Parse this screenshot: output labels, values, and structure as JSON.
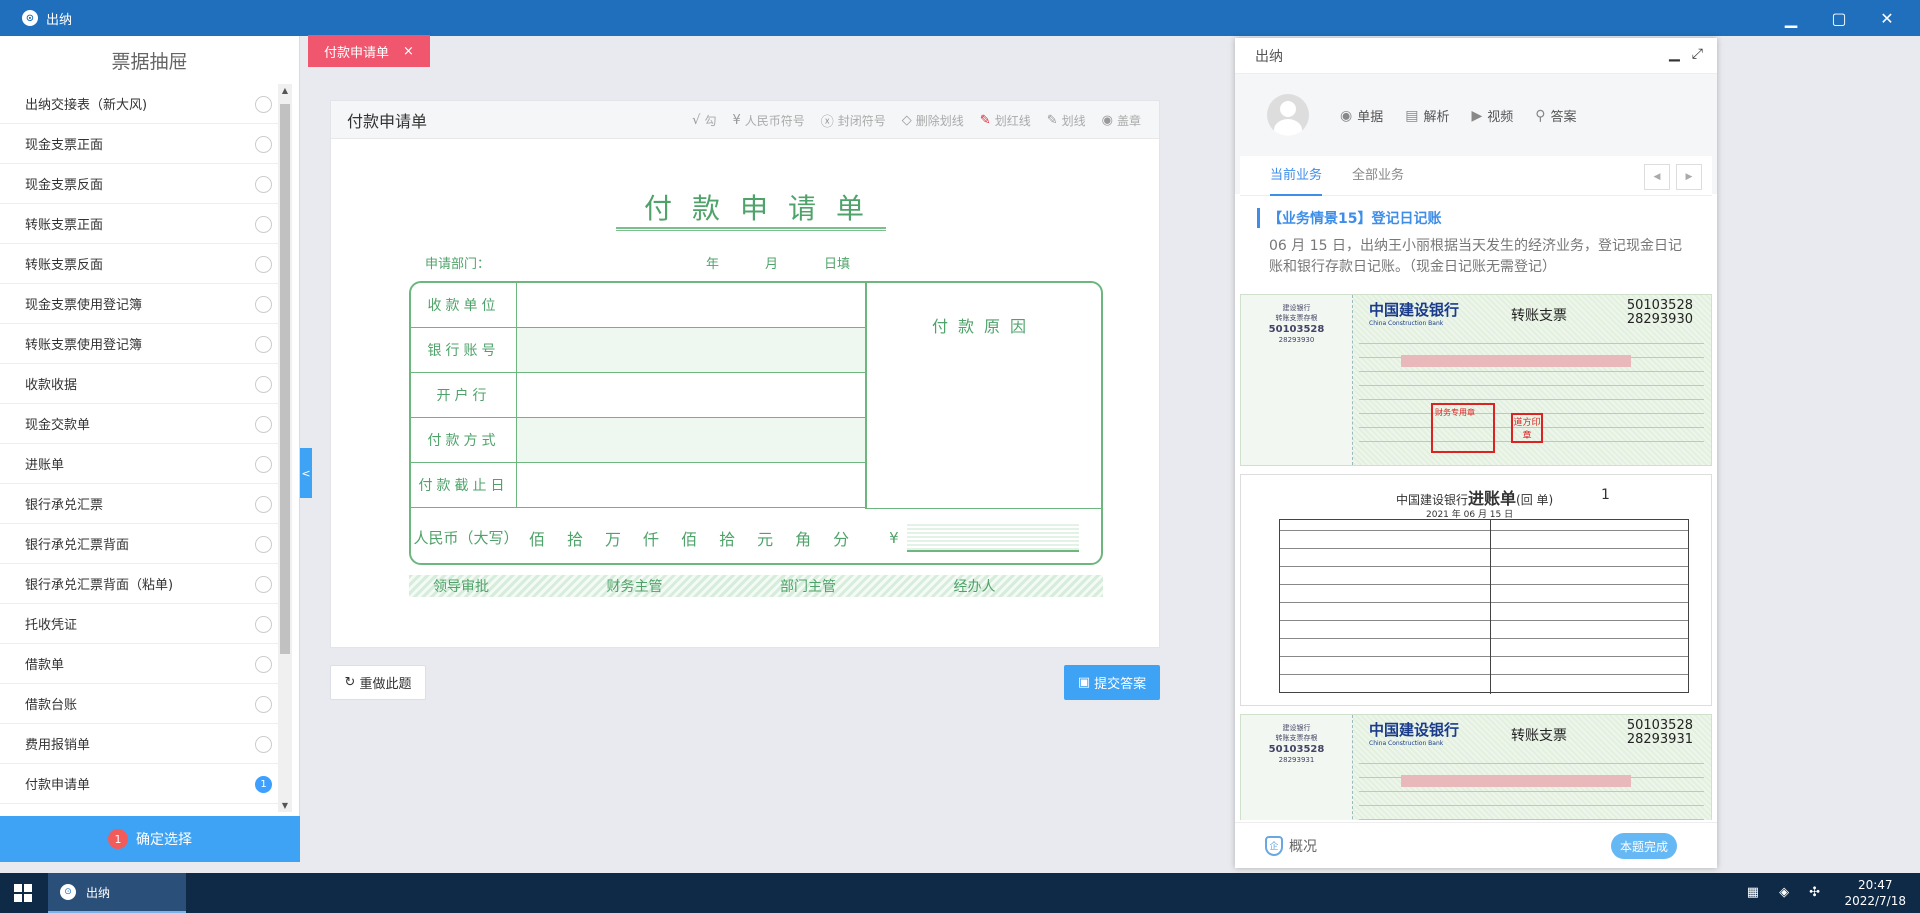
{
  "window": {
    "title": "出纳",
    "app_icon": "⊙",
    "minimize": "▁",
    "maximize": "▢",
    "close": "✕"
  },
  "sidebar": {
    "title": "票据抽屉",
    "items": [
      {
        "label": "出纳交接表（新大风)",
        "badge": ""
      },
      {
        "label": "现金支票正面",
        "badge": ""
      },
      {
        "label": "现金支票反面",
        "badge": ""
      },
      {
        "label": "转账支票正面",
        "badge": ""
      },
      {
        "label": "转账支票反面",
        "badge": ""
      },
      {
        "label": "现金支票使用登记簿",
        "badge": ""
      },
      {
        "label": "转账支票使用登记簿",
        "badge": ""
      },
      {
        "label": "收款收据",
        "badge": ""
      },
      {
        "label": "现金交款单",
        "badge": ""
      },
      {
        "label": "进账单",
        "badge": ""
      },
      {
        "label": "银行承兑汇票",
        "badge": ""
      },
      {
        "label": "银行承兑汇票背面",
        "badge": ""
      },
      {
        "label": "银行承兑汇票背面（粘单)",
        "badge": ""
      },
      {
        "label": "托收凭证",
        "badge": ""
      },
      {
        "label": "借款单",
        "badge": ""
      },
      {
        "label": "借款台账",
        "badge": ""
      },
      {
        "label": "费用报销单",
        "badge": ""
      },
      {
        "label": "付款申请单",
        "badge": "1"
      }
    ],
    "confirm_badge": "1",
    "confirm_label": "确定选择",
    "collapse": "<"
  },
  "tab": {
    "label": "付款申请单",
    "close": "×"
  },
  "form": {
    "header": "付款申请单",
    "tools": [
      {
        "icon": "√",
        "label": "勾",
        "red": false
      },
      {
        "icon": "¥",
        "label": "人民币符号",
        "red": false
      },
      {
        "icon": "ⓧ",
        "label": "封闭符号",
        "red": false
      },
      {
        "icon": "◇",
        "label": "删除划线",
        "red": false
      },
      {
        "icon": "✎",
        "label": "划红线",
        "red": true
      },
      {
        "icon": "✎",
        "label": "划线",
        "red": false
      },
      {
        "icon": "◉",
        "label": "盖章",
        "red": false
      }
    ],
    "title": "付款申请单",
    "apply_dept": "申请部门：",
    "date_parts": [
      "年",
      "月",
      "日填"
    ],
    "rows": [
      "收款单位",
      "银行账号",
      "开户行",
      "付款方式",
      "付款截止日"
    ],
    "reason": "付款原因",
    "rmb_label": "人民币（大写）",
    "units": [
      "佰",
      "拾",
      "万",
      "仟",
      "佰",
      "拾",
      "元",
      "角",
      "分"
    ],
    "yen": "¥",
    "signatures": [
      "领导审批",
      "财务主管",
      "部门主管",
      "经办人"
    ]
  },
  "buttons": {
    "reset": "重做此题",
    "reset_icon": "↻",
    "submit": "提交答案",
    "submit_icon": "▣"
  },
  "panel": {
    "title": "出纳",
    "links": [
      {
        "icon": "◉",
        "label": "单据"
      },
      {
        "icon": "▤",
        "label": "解析"
      },
      {
        "icon": "▶",
        "label": "视频"
      },
      {
        "icon": "⚲",
        "label": "答案"
      }
    ],
    "tabs": [
      "当前业务",
      "全部业务"
    ],
    "prev": "◀",
    "next": "▶",
    "task_title": "【业务情景15】登记日记账",
    "task_desc": "06 月 15 日，出纳王小丽根据当天发生的经济业务，登记现金日记账和银行存款日记账。（现金日记账无需登记）",
    "cheque1": {
      "stub_bank": "建设银行",
      "stub_kind": "转账支票存根",
      "stub_no1": "50103528",
      "stub_no2": "28293930",
      "bank": "中国建设银行",
      "bank_en": "China Construction Bank",
      "kind": "转账支票",
      "no1": "50103528",
      "no2": "28293930",
      "stamp": "财务专用章",
      "stamp2": "道方印章"
    },
    "deposit": {
      "bank": "中国建设银行",
      "title": "进账单",
      "sub": "(回 单)",
      "no": "1",
      "date": "2021 年 06 月 15 日"
    },
    "cheque2": {
      "stub_bank": "建设银行",
      "stub_kind": "转账支票存根",
      "stub_no1": "50103528",
      "stub_no2": "28293931",
      "bank": "中国建设银行",
      "bank_en": "China Construction Bank",
      "kind": "转账支票",
      "no1": "50103528",
      "no2": "28293931"
    },
    "footer": "概况",
    "footer_icon": "企",
    "done": "本题完成"
  },
  "taskbar": {
    "app": "出纳",
    "time": "20:47",
    "date": "2022/7/18",
    "tray": [
      "▦",
      "◈",
      "✣"
    ]
  }
}
